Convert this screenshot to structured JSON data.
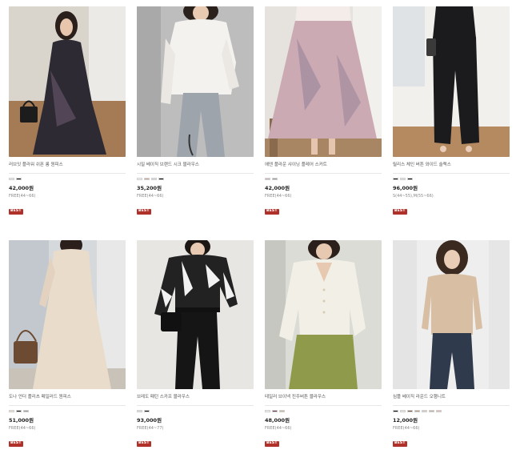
{
  "products": [
    {
      "name": "러브잇 플라워 쉬폰 롱 원피스",
      "price": "42,000원",
      "size": "FREE(44~66)",
      "badge": "BEST",
      "swatches": [
        "#e6e6e6",
        "#1f1f1f"
      ],
      "photo": {
        "bg": "#d9d4cc",
        "floor": "#a57b55",
        "garment": "#2d2a33",
        "accent": "#6b5a6e",
        "skin": "#e7c6ad",
        "hair": "#2a1f1a"
      }
    },
    {
      "name": "시밀 베이직 브랜드 시크 블라우스",
      "price": "35,200원",
      "size": "FREE(44~66)",
      "badge": "BEST",
      "swatches": [
        "#f2f2f2",
        "#c9a99a",
        "#d8d8d8",
        "#111111"
      ],
      "photo": {
        "bg": "#bdbdbd",
        "floor": "#cfcfcf",
        "garment": "#f4f2ee",
        "accent": "#9ea4ab",
        "skin": "#e9cbb4",
        "hair": "#2b211c"
      }
    },
    {
      "name": "에덴 플라운 샤이닝 플레어 스커트",
      "price": "42,000원",
      "size": "FREE(44~66)",
      "badge": "BEST",
      "swatches": [
        "#c9b6b9",
        "#9c9c9c"
      ],
      "photo": {
        "bg": "#e6e3df",
        "floor": "#a88563",
        "garment": "#cbaab3",
        "accent": "#8e7b93",
        "skin": "#e5c5ae",
        "hair": "#4a3a30"
      }
    },
    {
      "name": "릴리스 체인 버튼 와이드 슬랙스",
      "price": "96,000원",
      "size": "S(44~55),M(55~66)",
      "badge": "BEST",
      "swatches": [
        "#1c1c1c",
        "#dedede",
        "#111111"
      ],
      "photo": {
        "bg": "#f1f0ed",
        "floor": "#b58a60",
        "garment": "#1b1b1d",
        "accent": "#4a4a4a",
        "skin": "#e9cdb8",
        "hair": "#222222"
      }
    },
    {
      "name": "도나 언더 플리츠 페일러드 원피스",
      "price": "51,000원",
      "size": "FREE(44~66)",
      "badge": "BEST",
      "swatches": [
        "#e9dccb",
        "#1d1d1d",
        "#9a9a9a"
      ],
      "photo": {
        "bg": "#d6d9dc",
        "floor": "#c9c2b8",
        "garment": "#eadccb",
        "accent": "#6d4b32",
        "skin": "#e6c4aa",
        "hair": "#2a1f1a"
      }
    },
    {
      "name": "브레도 패턴 스카프 블라우스",
      "price": "93,000원",
      "size": "FREE(44~77)",
      "badge": "BEST",
      "swatches": [
        "#dddddd",
        "#1a1a1a"
      ],
      "photo": {
        "bg": "#e8e6e3",
        "floor": "#d7d3ce",
        "garment": "#222222",
        "accent": "#f2f2f2",
        "skin": "#e8cab3",
        "hair": "#1d1714"
      }
    },
    {
      "name": "테일러 브이넥 진주버튼 블라우스",
      "price": "48,000원",
      "size": "FREE(44~66)",
      "badge": "BEST",
      "swatches": [
        "#f4f1ea",
        "#6e3a4a",
        "#c8b89a"
      ],
      "photo": {
        "bg": "#dcdcd6",
        "floor": "#c4c1b8",
        "garment": "#f2efe6",
        "accent": "#8f9b4a",
        "skin": "#e7c8b1",
        "hair": "#2a1f1a"
      }
    },
    {
      "name": "심플 베이직 라운드 오행니트",
      "price": "12,000원",
      "size": "FREE(44~66)",
      "badge": "BEST",
      "swatches": [
        "#111111",
        "#e9e3dc",
        "#7a5a44",
        "#b79a82",
        "#d9cbbd",
        "#c8b0a8",
        "#e5b9b6"
      ],
      "photo": {
        "bg": "#eeeeee",
        "floor": "#e2e2e2",
        "garment": "#d8bea3",
        "accent": "#2f3b4c",
        "skin": "#e9cdb6",
        "hair": "#3a2a20"
      }
    }
  ]
}
